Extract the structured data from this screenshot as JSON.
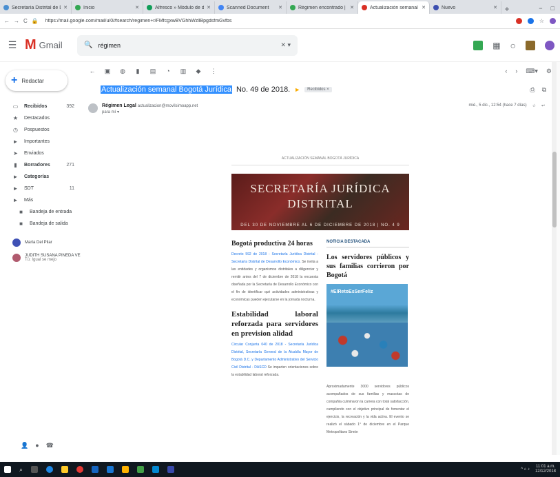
{
  "browser": {
    "tabs": [
      {
        "title": "Secretaría Distrital de Desarroll",
        "color": "#4a8fd1",
        "active": false
      },
      {
        "title": "Inicio",
        "color": "#34a853",
        "active": false
      },
      {
        "title": "Alfresco » Módulo de documen",
        "color": "#0f9d58",
        "active": false
      },
      {
        "title": "Scanned Document",
        "color": "#4285f4",
        "active": false
      },
      {
        "title": "Régimen encontrado | Intranet",
        "color": "#34a853",
        "active": false
      },
      {
        "title": "Actualización semanal Bogotá J",
        "color": "#d93025",
        "active": true
      },
      {
        "title": "Nuevo",
        "color": "#3c4fb0",
        "active": false
      }
    ],
    "url": "https://mail.google.com/mail/u/0/#search/regimen+r/FMfcgxwBVGhhWzllBpgdsfmGvfbs"
  },
  "gmail": {
    "app_name": "Gmail",
    "search_value": "régimen",
    "compose_label": "Redactar",
    "nav": [
      {
        "label": "Recibidos",
        "count": "392",
        "icon": "inbox-icon",
        "bold": true
      },
      {
        "label": "Destacados",
        "count": "",
        "icon": "star-icon",
        "bold": false
      },
      {
        "label": "Pospuestos",
        "count": "",
        "icon": "clock-icon",
        "bold": false
      },
      {
        "label": "Importantes",
        "count": "",
        "icon": "important-icon",
        "bold": false
      },
      {
        "label": "Enviados",
        "count": "",
        "icon": "send-icon",
        "bold": false
      },
      {
        "label": "Borradores",
        "count": "271",
        "icon": "draft-icon",
        "bold": true
      },
      {
        "label": "Categorías",
        "count": "",
        "icon": "label-icon",
        "bold": true
      },
      {
        "label": "SDT",
        "count": "11",
        "icon": "label-icon",
        "bold": false
      },
      {
        "label": "Más",
        "count": "",
        "icon": "label-icon",
        "bold": false
      }
    ],
    "subnav": [
      {
        "label": "Bandeja de entrada",
        "icon": "label-icon"
      },
      {
        "label": "Bandeja de salida",
        "icon": "label-icon"
      }
    ],
    "contacts": [
      {
        "name": "María Del Pilar",
        "color": "#3f51b5"
      },
      {
        "name": "JUDITH SUSANA PINEDA VE",
        "sub": "Tú: Igual se mejo",
        "color": "#b05a6e"
      }
    ]
  },
  "email": {
    "subject_highlight": "Actualización semanal Bogotá Jurídica",
    "subject_rest": "No. 49 de 2018.",
    "label_tag": "Recibidos ×",
    "sender_name": "Régimen Legal",
    "sender_email": "actualizacion@movilsimoapp.net",
    "to": "para mí",
    "date": "mié., 5 dic., 12:54 (hace 7 días)"
  },
  "newsletter": {
    "top_note": "ACTUALIZACIÓN SEMANAL BOGOTÁ JURÍDICA",
    "banner_line1": "SECRETARÍA JURÍDICA",
    "banner_line2": "DISTRITAL",
    "banner_line3": "DEL 30 DE NOVIEMBRE AL 6 DE DICIEMBRE DE 2018 | NO. 4 9",
    "left_title": "Bogotá productiva 24 horas",
    "left_body_link": "Decreto 592 de 2018 - Secretaría Jurídica Distrital - Secretaría Distrital de Desarrollo Económico.",
    "left_body": "Se invita a las entidades y organismos distritales a diligenciar y remitir antes del 7 de diciembre de 2018 la encuesta diseñada por la Secretaría de Desarrollo Económico con el fin de identificar qué actividades administrativas y económicas pueden ejecutarse en la jornada nocturna.",
    "left_title2": "Estabilidad laboral reforzada para servidores en prevision alidad",
    "left_body2_link": "Circular Conjunta 040 de 2018 - Secretaría Jurídica Distrital, Secretaría General de la Alcaldía Mayor de Bogotá D.C. y Departamento Administrativo del Servicio Civil Distrital - DASCD",
    "left_body2": "Se imparten orientaciones sobre la estabilidad laboral reforzada.",
    "right_tag": "NOTICIA DESTACADA",
    "right_title": "Los servidores públicos y sus familias corrieron por Bogotá",
    "photo_caption": "#ElRetoEsSerFeliz",
    "right_body": "Aproximadamente 3000 servidores públicos acompañados de sus familias y mascotas de compañía culminaron la carrera con total satisfacción, cumpliendo con el objetivo principal de fomentar el ejercicio, la recreación y la vida activa. El evento se realizó el sábado 1° de diciembre en el Parque Metropolitano Simón"
  },
  "taskbar": {
    "time": "11:01 a.m.",
    "date": "12/12/2018"
  }
}
